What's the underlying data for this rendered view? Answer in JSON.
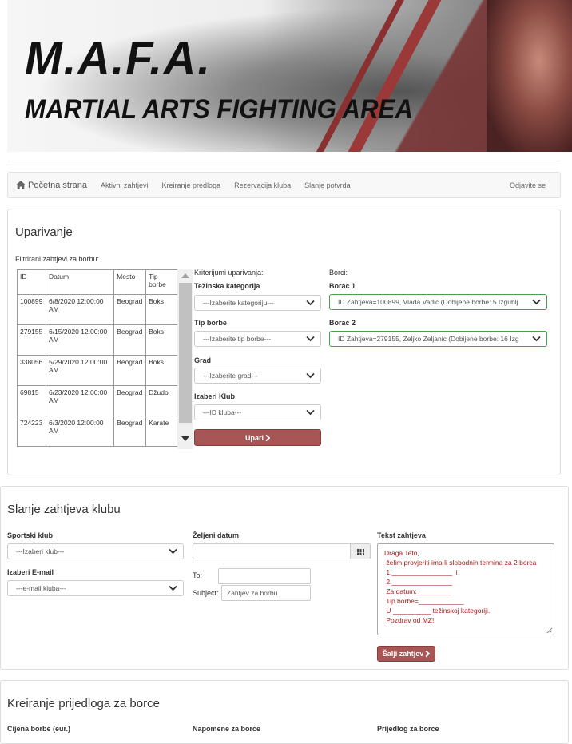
{
  "banner": {
    "logo": "M.A.F.A.",
    "subtitle": "MARTIAL ARTS FIGHTING AREA"
  },
  "nav": {
    "brand": "Početna strana",
    "items": [
      "Aktivni zahtjevi",
      "Kreiranje predloga",
      "Rezervacija kluba",
      "Slanje potvrda"
    ],
    "logout": "Odjavite se"
  },
  "matching": {
    "title": "Uparivanje",
    "filtered_label": "Filtrirani zahtjevi za borbu:",
    "table": {
      "headers": [
        "ID",
        "Datum",
        "Mesto",
        "Tip borbe"
      ],
      "rows": [
        [
          "100899",
          "6/8/2020 12:00:00 AM",
          "Beograd",
          "Boks"
        ],
        [
          "279155",
          "6/15/2020 12:00:00 AM",
          "Beograd",
          "Boks"
        ],
        [
          "338056",
          "5/29/2020 12:00:00 AM",
          "Beograd",
          "Boks"
        ],
        [
          "69815",
          "6/23/2020 12:00:00 AM",
          "Beograd",
          "Džudo"
        ],
        [
          "724223",
          "6/3/2020 12:00:00 AM",
          "Beograd",
          "Karate"
        ]
      ]
    },
    "criteria_label": "Kriterijumi uparivanja:",
    "weight_label": "Težinska kategorija",
    "weight_value": "---Izaberite kategoriju---",
    "type_label": "Tip borbe",
    "type_value": "---Izaberite tip borbe---",
    "city_label": "Grad",
    "city_value": "---Izaberite grad---",
    "club_label": "Izaberi Klub",
    "club_value": "---ID kluba---",
    "match_button": "Upari",
    "fighters_label": "Borci:",
    "fighter1_label": "Borac 1",
    "fighter1_value": "ID Zahtjeva=100899, Vlada Vadic (Dobijene borbe: 5 Izgublj",
    "fighter2_label": "Borac 2",
    "fighter2_value": "ID Zahtjeva=279155, Zeljko Zeljanic (Dobijene borbe: 16 Izg"
  },
  "club_request": {
    "title": "Slanje zahtjeva klubu",
    "sport_club_label": "Sportski klub",
    "sport_club_value": "---Izaberi klub---",
    "email_label": "Izaberi E-mail",
    "email_value": "---e-mail kluba---",
    "date_label": "Željeni datum",
    "date_value": "",
    "to_label": "To:",
    "to_value": "",
    "subject_label": "Subject:",
    "subject_value": "Zahtjev za borbu",
    "text_label": "Tekst zahtjeva",
    "text_value": "Draga Teto,\n želim provjeriti ima li slobodnih termina za 2 borca\n 1.________________  i\n 2.________________\n Za datum:_________\n Tip borbe=____________\n U __________ težinskoj kategoriji.\n Pozdrav od MZ!",
    "send_button": "Šalji zahtjev"
  },
  "proposal": {
    "title": "Kreiranje prijedloga za borce",
    "price_label": "Cijena borbe (eur.)",
    "notes_label": "Napomene za borce",
    "proposal_label": "Prijedlog za borce"
  }
}
